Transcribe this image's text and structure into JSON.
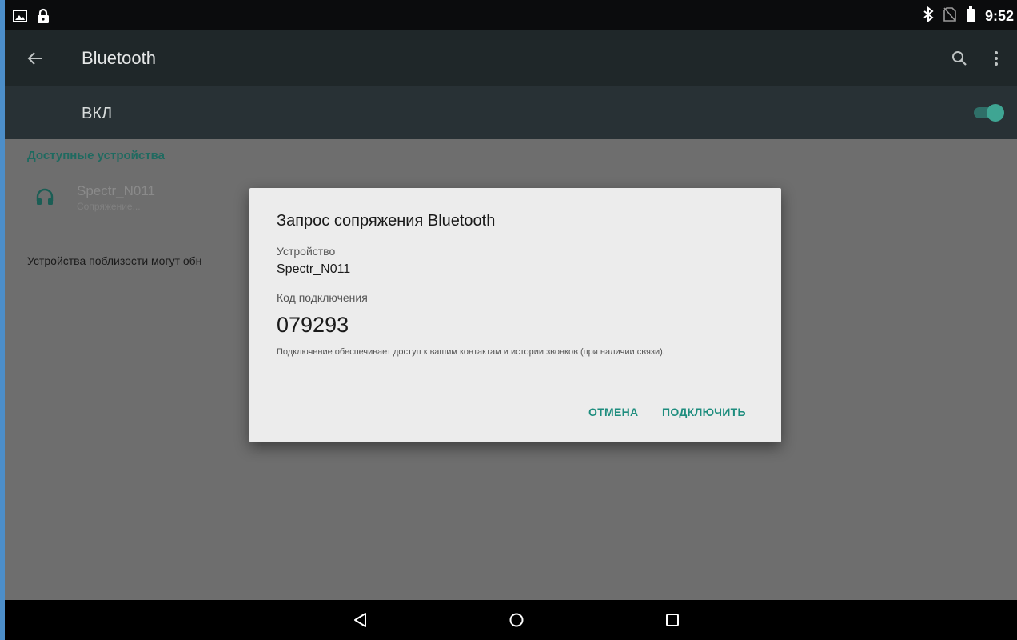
{
  "status_bar": {
    "time": "9:52",
    "left_icons": [
      "photo-icon",
      "lock-icon"
    ],
    "right_icons": [
      "bluetooth-icon",
      "no-sim-icon",
      "battery-icon"
    ]
  },
  "app_bar": {
    "title": "Bluetooth",
    "icons": [
      "back-arrow-icon",
      "search-icon",
      "more-vert-icon"
    ]
  },
  "switch_bar": {
    "label": "ВКЛ",
    "state": "on"
  },
  "content": {
    "section_title": "Доступные устройства",
    "device": {
      "name": "Spectr_N011",
      "status": "Сопряжение...",
      "icon": "headphones-icon"
    },
    "nearby_text": "Устройства поблизости могут обн"
  },
  "dialog": {
    "title": "Запрос сопряжения Bluetooth",
    "device_label": "Устройство",
    "device_value": "Spectr_N011",
    "code_label": "Код подключения",
    "code_value": "079293",
    "note": "Подключение обеспечивает доступ к вашим контактам и истории звонков (при наличии связи).",
    "cancel_label": "ОТМЕНА",
    "connect_label": "ПОДКЛЮЧИТЬ"
  },
  "nav_bar": {
    "icons": [
      "nav-back-icon",
      "nav-home-icon",
      "nav-recents-icon"
    ]
  },
  "colors": {
    "accent": "#1e8d7e",
    "app_bar": "#1f2729",
    "switch_bar": "#283135",
    "dimmed_content": "#6e6e6e",
    "dialog_bg": "#ececec"
  }
}
